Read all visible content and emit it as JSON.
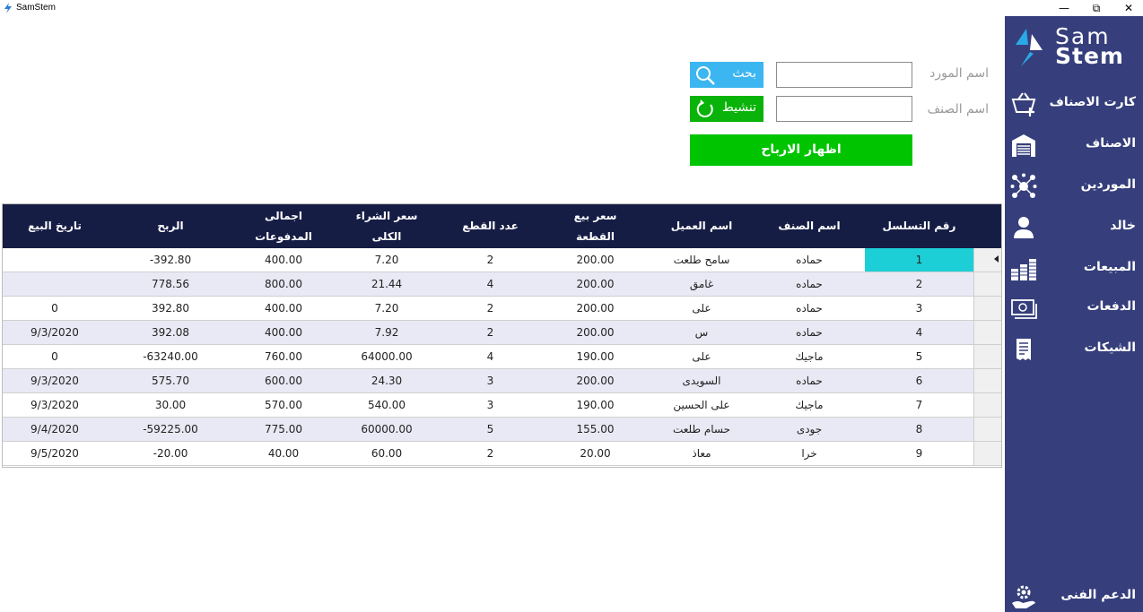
{
  "window": {
    "title": "SamStem",
    "minimize": "—",
    "restore": "⧉",
    "close": "✕"
  },
  "logo": {
    "line1": "Sam",
    "line2": "Stem"
  },
  "sidebar": {
    "items": [
      {
        "label": "كارت الاصناف",
        "icon": "basket-add-icon"
      },
      {
        "label": "الاصناف",
        "icon": "warehouse-icon"
      },
      {
        "label": "الموردين",
        "icon": "network-icon"
      },
      {
        "label": "خالد",
        "icon": "user-icon"
      },
      {
        "label": "المبيعات",
        "icon": "coins-icon"
      },
      {
        "label": "الدفعات",
        "icon": "money-icon"
      },
      {
        "label": "الشيكات",
        "icon": "receipt-icon"
      }
    ],
    "support": {
      "label": "الدعم الفنى",
      "icon": "support-gear-icon"
    }
  },
  "form": {
    "supplier_label": "اسم المورد",
    "supplier_value": "",
    "item_label": "اسم الصنف",
    "item_value": "",
    "search_label": "بحث",
    "refresh_label": "تنشيط",
    "profit_label": "اظهار الارباح"
  },
  "colors": {
    "sidebar_bg": "#363f7c",
    "header_bg": "#161d45",
    "search_btn": "#3cb6f0",
    "refresh_btn": "#09b309",
    "profit_btn": "#00c400",
    "selected_cell": "#1ccfd6",
    "alt_row": "#e9e9f5"
  },
  "grid": {
    "columns": [
      {
        "line1": "رقم التسلسل",
        "line2": ""
      },
      {
        "line1": "اسم الصنف",
        "line2": ""
      },
      {
        "line1": "اسم العميل",
        "line2": ""
      },
      {
        "line1": "سعر بيع",
        "line2": "القطعة"
      },
      {
        "line1": "عدد القطع",
        "line2": ""
      },
      {
        "line1": "سعر الشراء",
        "line2": "الكلى"
      },
      {
        "line1": "اجمالى",
        "line2": "المدفوعات"
      },
      {
        "line1": "الربح",
        "line2": ""
      },
      {
        "line1": "تاريخ البيع",
        "line2": ""
      }
    ],
    "rows": [
      [
        "1",
        "حماده",
        "سامح طلعت",
        "200.00",
        "2",
        "7.20",
        "400.00",
        "392.80-",
        ""
      ],
      [
        "2",
        "حماده",
        "غامق",
        "200.00",
        "4",
        "21.44",
        "800.00",
        "778.56",
        ""
      ],
      [
        "3",
        "حماده",
        "على",
        "200.00",
        "2",
        "7.20",
        "400.00",
        "392.80",
        "0"
      ],
      [
        "4",
        "حماده",
        "س",
        "200.00",
        "2",
        "7.92",
        "400.00",
        "392.08",
        "9/3/2020"
      ],
      [
        "5",
        "ماجيك",
        "على",
        "190.00",
        "4",
        "64000.00",
        "760.00",
        "63240.00-",
        "0"
      ],
      [
        "6",
        "حماده",
        "السويدى",
        "200.00",
        "3",
        "24.30",
        "600.00",
        "575.70",
        "9/3/2020"
      ],
      [
        "7",
        "ماجيك",
        "على الحسين",
        "190.00",
        "3",
        "540.00",
        "570.00",
        "30.00",
        "9/3/2020"
      ],
      [
        "8",
        "جودى",
        "حسام طلعت",
        "155.00",
        "5",
        "60000.00",
        "775.00",
        "59225.00-",
        "9/4/2020"
      ],
      [
        "9",
        "خرا",
        "معاذ",
        "20.00",
        "2",
        "60.00",
        "40.00",
        "20.00-",
        "9/5/2020"
      ]
    ],
    "selected_row": 1
  }
}
